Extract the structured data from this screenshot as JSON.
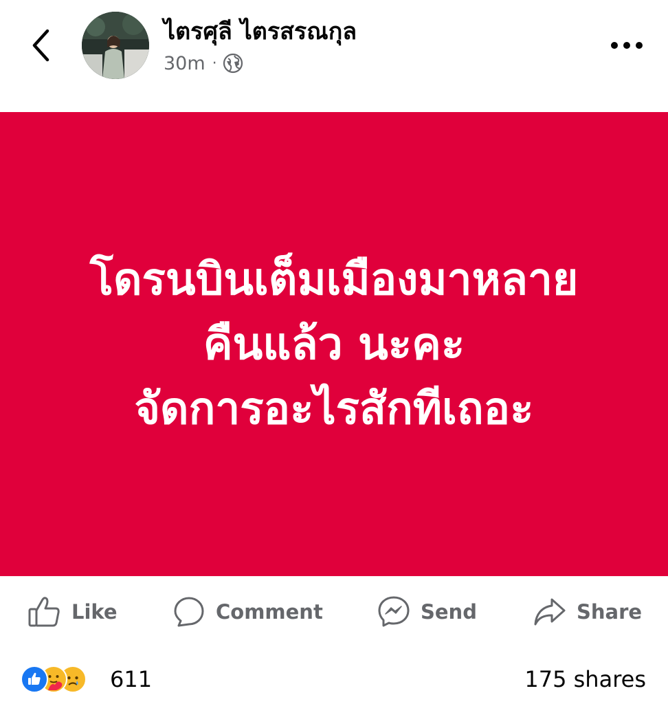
{
  "header": {
    "author_name": "ไตรศุลี ไตรสรณกุล",
    "timestamp": "30m",
    "separator": "·",
    "audience_icon": "globe-icon"
  },
  "post": {
    "background_color": "#e0003b",
    "text_color": "#ffffff",
    "lines": [
      "โดรนบินเต็มเมืองมาหลาย",
      "คืนแล้ว นะคะ",
      "จัดการอะไรสักทีเถอะ"
    ]
  },
  "actions": {
    "like_label": "Like",
    "comment_label": "Comment",
    "send_label": "Send",
    "share_label": "Share"
  },
  "reactions": {
    "icons": [
      "like-icon",
      "care-icon",
      "sad-icon"
    ],
    "count": "611",
    "shares": "175 shares"
  }
}
